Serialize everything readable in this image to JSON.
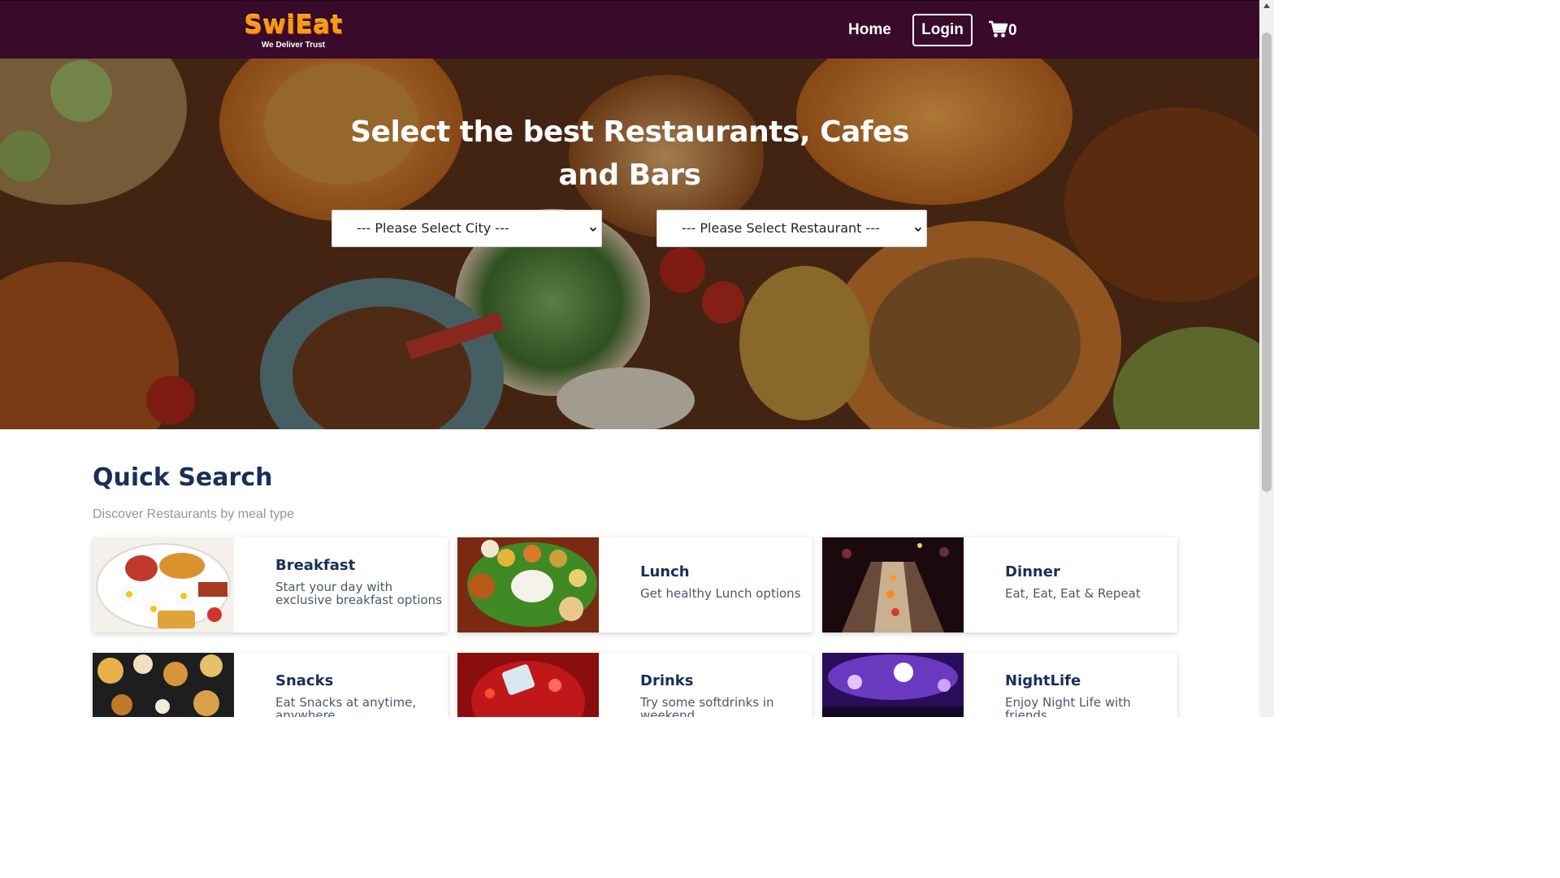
{
  "header": {
    "brand_name": "SwiEat",
    "brand_tagline": "We Deliver Trust",
    "nav_home": "Home",
    "nav_login": "Login",
    "cart_count": "0"
  },
  "hero": {
    "title": "Select the best Restaurants, Cafes and Bars",
    "city_select": "--- Please Select City ---",
    "restaurant_select": "--- Please Select Restaurant ---"
  },
  "quick_search": {
    "title": "Quick Search",
    "subtitle": "Discover Restaurants by meal type",
    "cards": [
      {
        "title": "Breakfast",
        "desc": "Start your day with exclusive breakfast options"
      },
      {
        "title": "Lunch",
        "desc": "Get healthy Lunch options"
      },
      {
        "title": "Dinner",
        "desc": "Eat, Eat, Eat & Repeat"
      },
      {
        "title": "Snacks",
        "desc": "Eat Snacks at anytime, anywhere"
      },
      {
        "title": "Drinks",
        "desc": "Try some softdrinks in weekend"
      },
      {
        "title": "NightLife",
        "desc": "Enjoy Night Life with friends"
      }
    ]
  },
  "colors": {
    "navbar": "#3a0a2a",
    "brand": "#f39c12",
    "heading": "#192f59",
    "subtext": "#8c96a9"
  },
  "icons": [
    "cart-icon",
    "chevron-down-icon",
    "scroll-up-arrow-icon"
  ]
}
